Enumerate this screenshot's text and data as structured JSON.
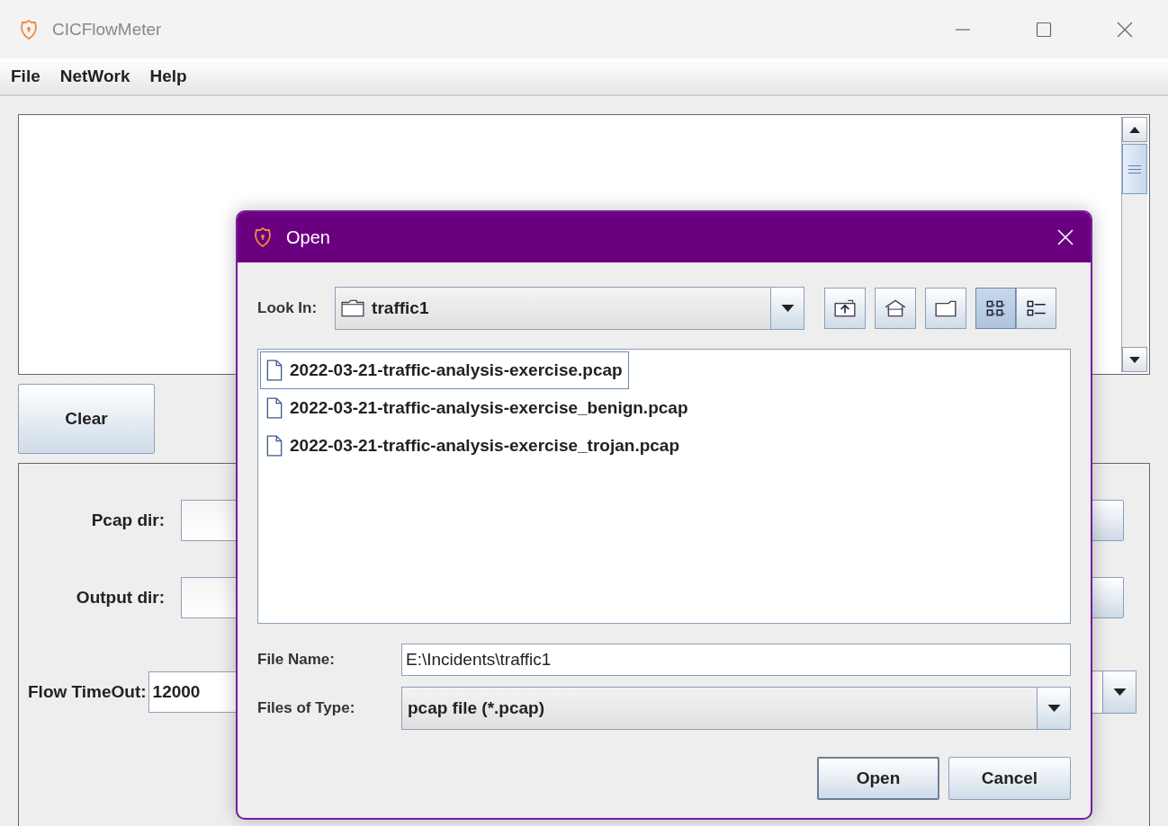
{
  "window": {
    "title": "CICFlowMeter"
  },
  "menu": [
    "File",
    "NetWork",
    "Help"
  ],
  "clear_button": "Clear",
  "form": {
    "pcap_dir_label": "Pcap dir:",
    "output_dir_label": "Output dir:",
    "flow_timeout_label": "Flow TimeOut:",
    "flow_timeout_value": "12000"
  },
  "dialog": {
    "title": "Open",
    "look_in_label": "Look In:",
    "look_in_value": "traffic1",
    "view_modes": [
      {
        "kind": "list",
        "selected": true
      },
      {
        "kind": "details",
        "selected": false
      }
    ],
    "files": [
      {
        "name": "2022-03-21-traffic-analysis-exercise.pcap",
        "selected": true
      },
      {
        "name": "2022-03-21-traffic-analysis-exercise_benign.pcap",
        "selected": false
      },
      {
        "name": "2022-03-21-traffic-analysis-exercise_trojan.pcap",
        "selected": false
      }
    ],
    "file_name_label": "File Name:",
    "file_name_value": "E:\\Incidents\\traffic1",
    "file_type_label": "Files of Type:",
    "file_type_value": "pcap file (*.pcap)",
    "buttons": [
      {
        "label": "Open",
        "default": true
      },
      {
        "label": "Cancel",
        "default": false
      }
    ]
  }
}
